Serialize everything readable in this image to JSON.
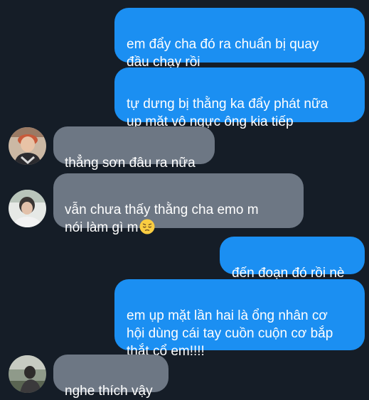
{
  "conversation": {
    "messages": [
      {
        "sender": "me",
        "text": "em đẩy cha đó ra chuẩn bị quay\nđầu chạy rồi"
      },
      {
        "sender": "me",
        "text": "tự dưng bị thằng ka đẩy phát nữa\nụp mặt vô ngực ông kia tiếp"
      },
      {
        "sender": "other",
        "text": "thẳng sơn đâu ra nữa"
      },
      {
        "sender": "other",
        "text": "vẫn chưa thấy thằng cha emo m\nnói làm gì m",
        "emoji": "pensive-face-emoji"
      },
      {
        "sender": "me",
        "text": "đến đoạn đó rồi nè"
      },
      {
        "sender": "me",
        "text": "em ụp mặt lần hai là ổng nhân cơ\nhội dùng cái tay cuồn cuộn cơ bắp\nthắt cổ em!!!!"
      },
      {
        "sender": "other",
        "text": "nghe thích vậy"
      }
    ]
  },
  "colors": {
    "background": "#151d27",
    "outgoing_bubble": "#1b8ff2",
    "incoming_bubble": "#6d7784",
    "text": "#ffffff"
  }
}
